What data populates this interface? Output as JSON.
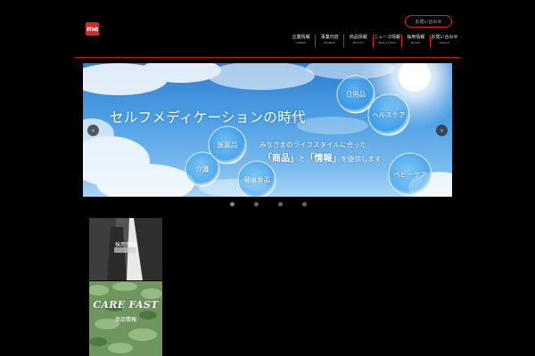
{
  "header": {
    "logo_text": "me",
    "contact_label": "お問い合わせ"
  },
  "nav": {
    "items": [
      {
        "jp": "企業情報",
        "en": "COMPANY"
      },
      {
        "jp": "事業内容",
        "en": "BUSINESS"
      },
      {
        "jp": "商品情報",
        "en": "PRODUCT"
      },
      {
        "jp": "ニュース情報",
        "en": "NEWS & TOPICS"
      },
      {
        "jp": "採用情報",
        "en": "RECRUIT"
      },
      {
        "jp": "お問い合わせ",
        "en": "CONTACT"
      }
    ]
  },
  "hero": {
    "title": "セルフメディケーションの時代",
    "subtitle_line1": "みなさまのライフスタイルに合った",
    "product_word": "「商品」",
    "conjunction": "と",
    "info_word": "「情報」",
    "subtitle_end": "を提供します",
    "bubbles": {
      "daily": "日用品",
      "healthcare": "ヘルスケア",
      "medicine": "医薬品",
      "care": "介護",
      "health_food": "健康食品",
      "baby": "ベビーケア"
    },
    "prev_icon": "‹",
    "next_icon": "›"
  },
  "slider": {
    "slide_count": 4,
    "active_index": 0
  },
  "banners": {
    "recruit_label": "採用情報",
    "carefast_logo": "CARE FAST",
    "carefast_label": "商品情報"
  },
  "colors": {
    "background": "#000000",
    "accent_red": "#d7262b",
    "sky_blue": "#4c9ee3"
  }
}
